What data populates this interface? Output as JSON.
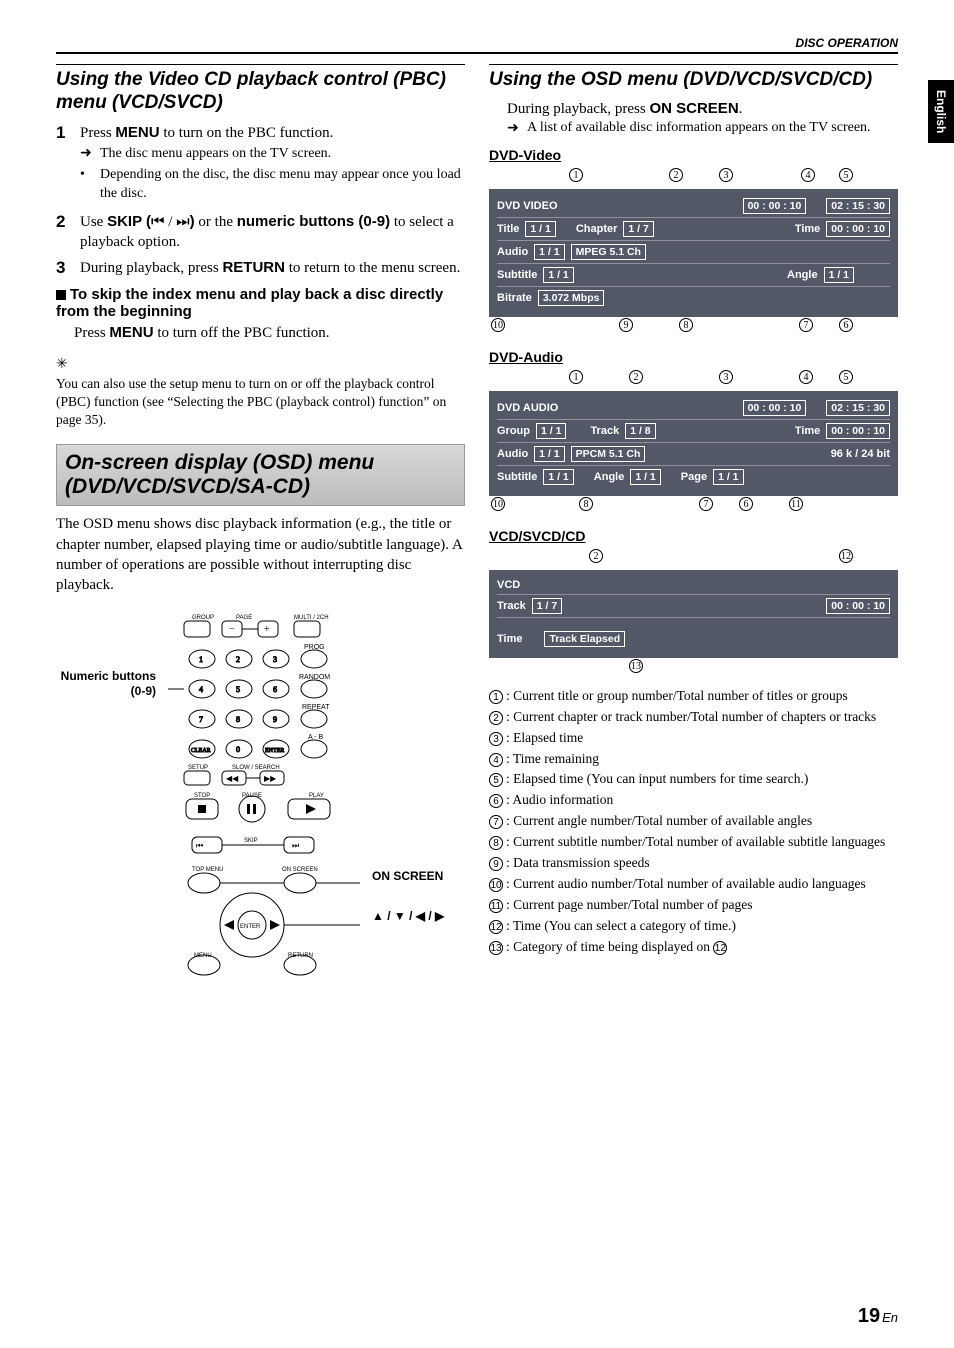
{
  "header": {
    "section": "DISC OPERATION",
    "lang_tab": "English"
  },
  "left": {
    "title": "Using the Video CD playback control (PBC) menu (VCD/SVCD)",
    "step1": {
      "n": "1",
      "text_pre": "Press ",
      "btn": "MENU",
      "text_post": " to turn on the PBC function."
    },
    "step1_b1": "The disc menu appears on the TV screen.",
    "step1_b2": "Depending on the disc, the disc menu may appear once you load the disc.",
    "step2": {
      "n": "2",
      "pre": "Use ",
      "skip": "SKIP (",
      "skip_icons": "⏮ / ⏭",
      "skip_post": ")",
      "or": " or the ",
      "numeric": "numeric buttons (0-9)",
      "post": " to select a playback option."
    },
    "step3": {
      "n": "3",
      "pre": "During playback, press ",
      "btn": "RETURN",
      "post": " to return to the menu screen."
    },
    "sub_title": "To skip the index menu and play back a disc directly from the beginning",
    "sub_text_pre": "Press ",
    "sub_btn": "MENU",
    "sub_text_post": " to turn off the PBC function.",
    "tip": "You can also use the setup menu to turn on or off the playback control (PBC) function (see “Selecting the PBC (playback control) function” on page 35).",
    "band_title": "On-screen display (OSD) menu (DVD/VCD/SVCD/SA-CD)",
    "band_para": "The OSD menu shows disc playback information (e.g., the title or chapter number, elapsed playing time or audio/subtitle language). A number of operations are possible without interrupting disc playback.",
    "remote": {
      "left_label": "Numeric buttons (0-9)",
      "right_onscreen": "ON SCREEN",
      "right_arrows": "▲ / ▼ / ◀ / ▶",
      "labels": {
        "group": "GROUP",
        "page": "PAGE",
        "multi": "MULTI / 2CH",
        "prog": "PROG",
        "random": "RANDOM",
        "repeat": "REPEAT",
        "ab": "A - B",
        "clear": "CLEAR",
        "enter": "ENTER",
        "setup": "SETUP",
        "slow": "SLOW / SEARCH",
        "stop": "STOP",
        "pause": "PAUSE",
        "play": "PLAY",
        "skip": "SKIP",
        "topmenu": "TOP MENU",
        "onscreen": "ON SCREEN",
        "menu": "MENU",
        "return": "RETURN",
        "enter2": "ENTER"
      }
    }
  },
  "right": {
    "title": "Using the OSD menu (DVD/VCD/SVCD/CD)",
    "line_pre": "During playback, press ",
    "line_btn": "ON SCREEN",
    "line_post": ".",
    "bullet": "A list of available disc information appears on the TV screen.",
    "sect1": "DVD-Video",
    "sect2": "DVD-Audio",
    "sect3": "VCD/SVCD/CD",
    "panel1": {
      "r1": {
        "type": "DVD VIDEO",
        "t1": "00 : 00 : 10",
        "t2": "02 : 15 : 30"
      },
      "r2": {
        "title_l": "Title",
        "title_v": "1 / 1",
        "chap_l": "Chapter",
        "chap_v": "1 / 7",
        "time_l": "Time",
        "time_v": "00 : 00 : 10"
      },
      "r3": {
        "audio_l": "Audio",
        "audio_v": "1 / 1",
        "codec": "MPEG  5.1 Ch"
      },
      "r4": {
        "sub_l": "Subtitle",
        "sub_v": "1 / 1",
        "angle_l": "Angle",
        "angle_v": "1 / 1"
      },
      "r5": {
        "bit_l": "Bitrate",
        "bit_v": "3.072 Mbps"
      }
    },
    "panel2": {
      "r1": {
        "type": "DVD AUDIO",
        "t1": "00 : 00 : 10",
        "t2": "02 : 15 : 30"
      },
      "r2": {
        "grp_l": "Group",
        "grp_v": "1 / 1",
        "trk_l": "Track",
        "trk_v": "1 / 8",
        "time_l": "Time",
        "time_v": "00 : 00 : 10"
      },
      "r3": {
        "audio_l": "Audio",
        "audio_v": "1 / 1",
        "codec": "PPCM  5.1 Ch",
        "bits": "96 k / 24 bit"
      },
      "r4": {
        "sub_l": "Subtitle",
        "sub_v": "1 / 1",
        "angle_l": "Angle",
        "angle_v": "1 / 1",
        "page_l": "Page",
        "page_v": "1 / 1"
      }
    },
    "panel3": {
      "r1": {
        "type": "VCD"
      },
      "r2": {
        "trk_l": "Track",
        "trk_v": "1 / 7",
        "time_v": "00 : 00 : 10"
      },
      "r3": {
        "time_l": "Time",
        "mode": "Track Elapsed"
      }
    },
    "legend": {
      "1": "Current title or group number/Total number of titles or groups",
      "2": "Current chapter or track number/Total number of chapters or tracks",
      "3": "Elapsed time",
      "4": "Time remaining",
      "5": "Elapsed time (You can input numbers for time search.)",
      "6": "Audio information",
      "7": "Current angle number/Total number of available angles",
      "8": "Current subtitle number/Total number of available subtitle languages",
      "9": "Data transmission speeds",
      "10": "Current audio number/Total number of available audio languages",
      "11": "Current page number/Total number of pages",
      "12": "Time (You can select a category of time.)",
      "13_pre": "Category of time being displayed on ",
      "13_ref": "12"
    }
  },
  "footer": {
    "page": "19",
    "lang": "En"
  }
}
